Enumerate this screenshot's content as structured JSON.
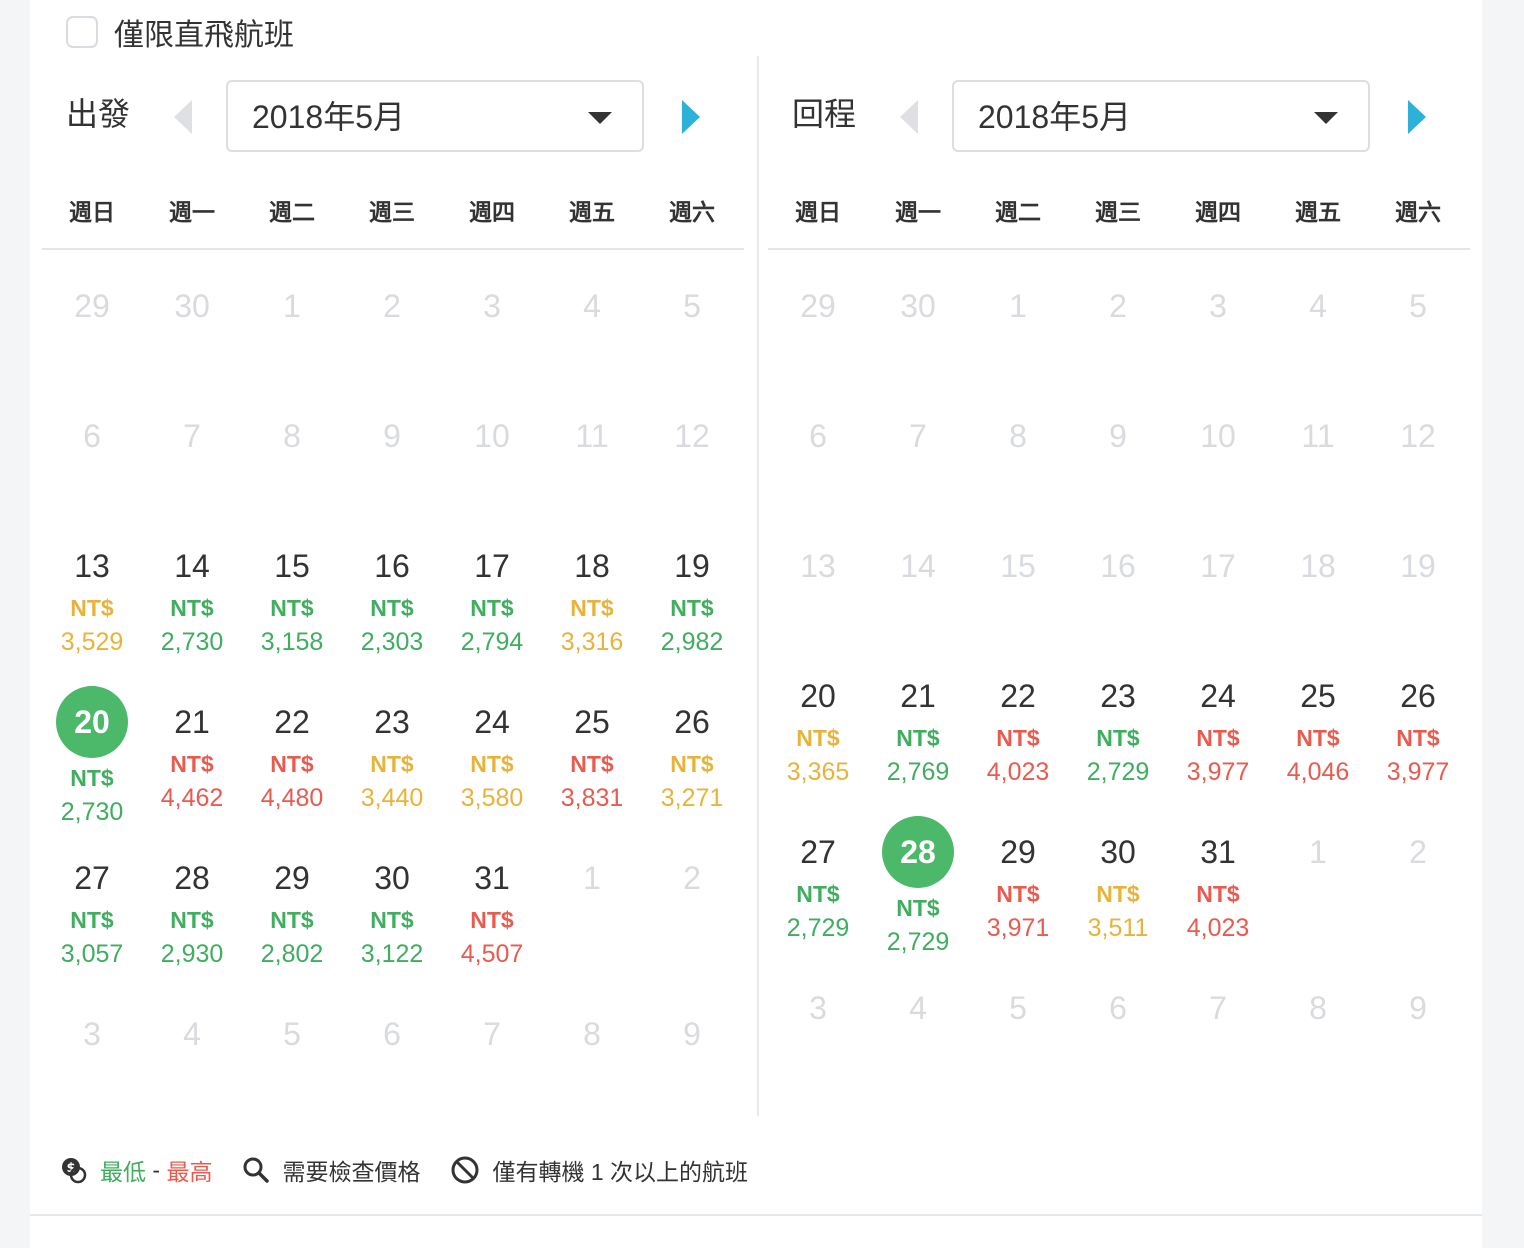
{
  "direct_only": {
    "label": "僅限直飛航班",
    "checked": false
  },
  "calendars": [
    {
      "id": "depart",
      "title": "出發",
      "month": "2018年5月",
      "weekdays": [
        "週日",
        "週一",
        "週二",
        "週三",
        "週四",
        "週五",
        "週六"
      ],
      "weeks": [
        [
          {
            "d": "29",
            "out": true
          },
          {
            "d": "30",
            "out": true
          },
          {
            "d": "1",
            "out": true
          },
          {
            "d": "2",
            "out": true
          },
          {
            "d": "3",
            "out": true
          },
          {
            "d": "4",
            "out": true
          },
          {
            "d": "5",
            "out": true
          }
        ],
        [
          {
            "d": "6",
            "out": true
          },
          {
            "d": "7",
            "out": true
          },
          {
            "d": "8",
            "out": true
          },
          {
            "d": "9",
            "out": true
          },
          {
            "d": "10",
            "out": true
          },
          {
            "d": "11",
            "out": true
          },
          {
            "d": "12",
            "out": true
          }
        ],
        [
          {
            "d": "13",
            "p": "NT$",
            "a": "3,529",
            "c": "orange"
          },
          {
            "d": "14",
            "p": "NT$",
            "a": "2,730",
            "c": "green"
          },
          {
            "d": "15",
            "p": "NT$",
            "a": "3,158",
            "c": "green"
          },
          {
            "d": "16",
            "p": "NT$",
            "a": "2,303",
            "c": "green"
          },
          {
            "d": "17",
            "p": "NT$",
            "a": "2,794",
            "c": "green"
          },
          {
            "d": "18",
            "p": "NT$",
            "a": "3,316",
            "c": "orange"
          },
          {
            "d": "19",
            "p": "NT$",
            "a": "2,982",
            "c": "green"
          }
        ],
        [
          {
            "d": "20",
            "p": "NT$",
            "a": "2,730",
            "c": "green",
            "sel": true
          },
          {
            "d": "21",
            "p": "NT$",
            "a": "4,462",
            "c": "red"
          },
          {
            "d": "22",
            "p": "NT$",
            "a": "4,480",
            "c": "red"
          },
          {
            "d": "23",
            "p": "NT$",
            "a": "3,440",
            "c": "orange"
          },
          {
            "d": "24",
            "p": "NT$",
            "a": "3,580",
            "c": "orange"
          },
          {
            "d": "25",
            "p": "NT$",
            "a": "3,831",
            "c": "red"
          },
          {
            "d": "26",
            "p": "NT$",
            "a": "3,271",
            "c": "orange"
          }
        ],
        [
          {
            "d": "27",
            "p": "NT$",
            "a": "3,057",
            "c": "green"
          },
          {
            "d": "28",
            "p": "NT$",
            "a": "2,930",
            "c": "green"
          },
          {
            "d": "29",
            "p": "NT$",
            "a": "2,802",
            "c": "green"
          },
          {
            "d": "30",
            "p": "NT$",
            "a": "3,122",
            "c": "green"
          },
          {
            "d": "31",
            "p": "NT$",
            "a": "4,507",
            "c": "red"
          },
          {
            "d": "1",
            "out": true
          },
          {
            "d": "2",
            "out": true
          }
        ],
        [
          {
            "d": "3",
            "out": true
          },
          {
            "d": "4",
            "out": true
          },
          {
            "d": "5",
            "out": true
          },
          {
            "d": "6",
            "out": true
          },
          {
            "d": "7",
            "out": true
          },
          {
            "d": "8",
            "out": true
          },
          {
            "d": "9",
            "out": true
          }
        ]
      ]
    },
    {
      "id": "return",
      "title": "回程",
      "month": "2018年5月",
      "weekdays": [
        "週日",
        "週一",
        "週二",
        "週三",
        "週四",
        "週五",
        "週六"
      ],
      "weeks": [
        [
          {
            "d": "29",
            "out": true
          },
          {
            "d": "30",
            "out": true
          },
          {
            "d": "1",
            "out": true
          },
          {
            "d": "2",
            "out": true
          },
          {
            "d": "3",
            "out": true
          },
          {
            "d": "4",
            "out": true
          },
          {
            "d": "5",
            "out": true
          }
        ],
        [
          {
            "d": "6",
            "out": true
          },
          {
            "d": "7",
            "out": true
          },
          {
            "d": "8",
            "out": true
          },
          {
            "d": "9",
            "out": true
          },
          {
            "d": "10",
            "out": true
          },
          {
            "d": "11",
            "out": true
          },
          {
            "d": "12",
            "out": true
          }
        ],
        [
          {
            "d": "13",
            "out": true
          },
          {
            "d": "14",
            "out": true
          },
          {
            "d": "15",
            "out": true
          },
          {
            "d": "16",
            "out": true
          },
          {
            "d": "17",
            "out": true
          },
          {
            "d": "18",
            "out": true
          },
          {
            "d": "19",
            "out": true
          }
        ],
        [
          {
            "d": "20",
            "p": "NT$",
            "a": "3,365",
            "c": "orange"
          },
          {
            "d": "21",
            "p": "NT$",
            "a": "2,769",
            "c": "green"
          },
          {
            "d": "22",
            "p": "NT$",
            "a": "4,023",
            "c": "red"
          },
          {
            "d": "23",
            "p": "NT$",
            "a": "2,729",
            "c": "green"
          },
          {
            "d": "24",
            "p": "NT$",
            "a": "3,977",
            "c": "red"
          },
          {
            "d": "25",
            "p": "NT$",
            "a": "4,046",
            "c": "red"
          },
          {
            "d": "26",
            "p": "NT$",
            "a": "3,977",
            "c": "red"
          }
        ],
        [
          {
            "d": "27",
            "p": "NT$",
            "a": "2,729",
            "c": "green"
          },
          {
            "d": "28",
            "p": "NT$",
            "a": "2,729",
            "c": "green",
            "sel": true
          },
          {
            "d": "29",
            "p": "NT$",
            "a": "3,971",
            "c": "red"
          },
          {
            "d": "30",
            "p": "NT$",
            "a": "3,511",
            "c": "orange"
          },
          {
            "d": "31",
            "p": "NT$",
            "a": "4,023",
            "c": "red"
          },
          {
            "d": "1",
            "out": true
          },
          {
            "d": "2",
            "out": true
          }
        ],
        [
          {
            "d": "3",
            "out": true
          },
          {
            "d": "4",
            "out": true
          },
          {
            "d": "5",
            "out": true
          },
          {
            "d": "6",
            "out": true
          },
          {
            "d": "7",
            "out": true
          },
          {
            "d": "8",
            "out": true
          },
          {
            "d": "9",
            "out": true
          }
        ]
      ]
    }
  ],
  "legend": {
    "low": "最低",
    "sep": " - ",
    "high": "最高",
    "check_price": "需要檢查價格",
    "connecting": "僅有轉機 1 次以上的航班"
  },
  "colors": {
    "green": "#3fae5f",
    "orange": "#e8b33a",
    "red": "#e85b4f",
    "accent": "#2eb1d8"
  }
}
